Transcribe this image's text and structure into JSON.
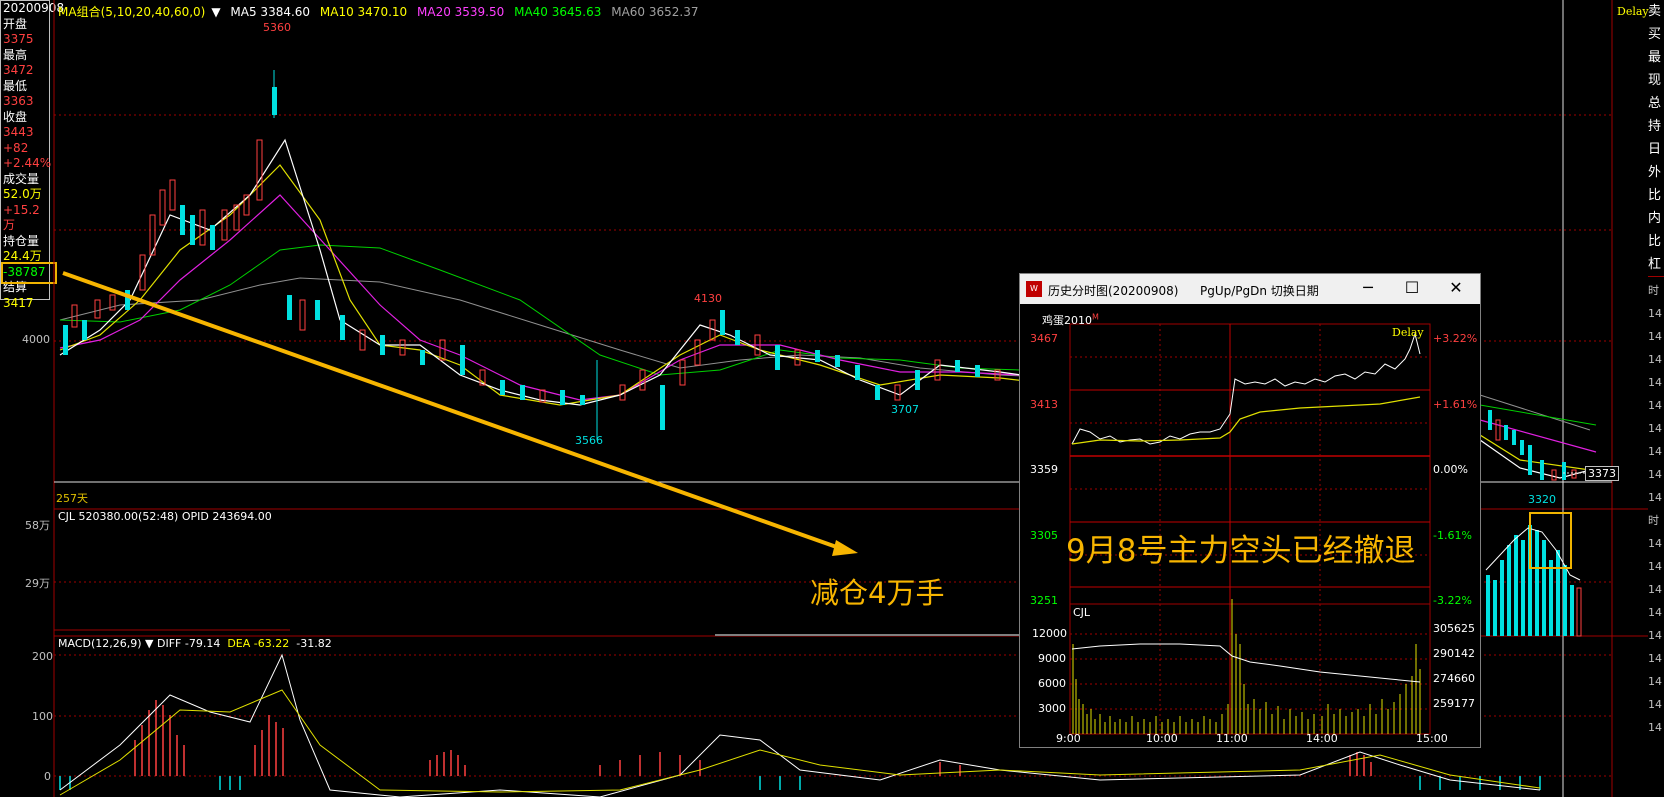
{
  "info_panel": {
    "date": "20200908",
    "open_label": "开盘",
    "open": "3375",
    "high_label": "最高",
    "high": "3472",
    "low_label": "最低",
    "low": "3363",
    "close_label": "收盘",
    "close": "3443",
    "change": "+82",
    "change_pct": "+2.44%",
    "volume_label": "成交量",
    "volume": "52.0万",
    "volume_chg": "+15.2万",
    "oi_label": "持仓量",
    "oi": "24.4万",
    "oi_chg": "-38787",
    "settle_label": "结算",
    "settle": "3417"
  },
  "main_legend": {
    "ma_group": "MA组合(5,10,20,40,60,0)",
    "ma5": "MA5 3384.60",
    "ma10": "MA10 3470.10",
    "ma20": "MA20 3539.50",
    "ma40": "MA40 3645.63",
    "ma60": "MA60 3652.37",
    "delay": "Delay"
  },
  "main_chart": {
    "price_label_high": "5360",
    "price_label_4130": "4130",
    "price_label_3566": "3566",
    "price_label_3707": "3707",
    "price_label_3320": "3320",
    "current_price": "3373",
    "axis_4000": "4000",
    "days": "257天"
  },
  "volume_panel": {
    "legend": "CJL  520380.00(52:48)  OPID 243694.00",
    "axis_58": "58万",
    "axis_29": "29万"
  },
  "macd_panel": {
    "legend_name": "MACD(12,26,9)",
    "diff": "DIFF -79.14",
    "dea": "DEA -63.22",
    "macd": "-31.82",
    "axis_200": "200",
    "axis_100": "100",
    "axis_0": "0"
  },
  "annotation": {
    "reduce_text": "减仓4万手",
    "popup_overlay": "9月8号主力空头已经撤退"
  },
  "popup": {
    "title": "历史分时图(20200908)",
    "hint": "PgUp/PgDn 切换日期",
    "minimize": "─",
    "maximize": "☐",
    "close": "✕",
    "symbol": "鸡蛋2010",
    "symbol_mark": "M",
    "delay": "Delay",
    "y_left": [
      "3467",
      "3413",
      "3359",
      "3305",
      "3251"
    ],
    "y_right": [
      "+3.22%",
      "+1.61%",
      "0.00%",
      "-1.61%",
      "-3.22%"
    ],
    "cjl_label": "CJL",
    "vol_left": [
      "12000",
      "9000",
      "6000",
      "3000"
    ],
    "vol_right": [
      "305625",
      "290142",
      "274660",
      "259177"
    ],
    "x_labels": [
      "9:00",
      "10:00",
      "11:00",
      "14:00",
      "15:00"
    ]
  },
  "right_strip": [
    "卖",
    "买",
    "最",
    "现",
    "总",
    "持",
    "日",
    "外",
    "比",
    "内",
    "比",
    "杠"
  ],
  "right_axis": [
    "时",
    "14",
    "14",
    "14",
    "14",
    "14",
    "14",
    "14",
    "14",
    "14",
    "时",
    "14",
    "14",
    "14",
    "14",
    "14",
    "14",
    "14",
    "14",
    "14"
  ]
}
